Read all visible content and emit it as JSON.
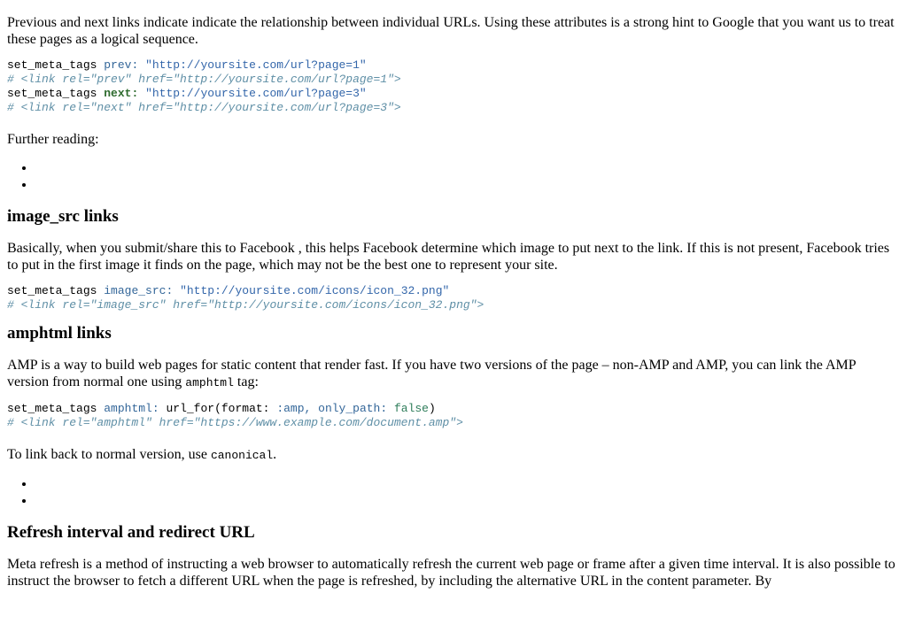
{
  "sections": {
    "prev_next": {
      "intro": "Previous and next links indicate indicate the relationship between individual URLs. Using these attributes is a strong hint to Google that you want us to treat these pages as a logical sequence.",
      "code": {
        "l1_cmd": "set_meta_tags",
        "l1_key": "prev:",
        "l1_val": "\"http://yoursite.com/url?page=1\"",
        "l2_comment": "# <link rel=\"prev\" href=\"http://yoursite.com/url?page=1\">",
        "l3_cmd": "set_meta_tags",
        "l3_key": "next:",
        "l3_val": "\"http://yoursite.com/url?page=3\"",
        "l4_comment": "# <link rel=\"next\" href=\"http://yoursite.com/url?page=3\">"
      },
      "further_reading": "Further reading:"
    },
    "image_src": {
      "heading": "image_src links",
      "body": "Basically, when you submit/share this to Facebook , this helps Facebook determine which image to put next to the link. If this is not present, Facebook tries to put in the first image it finds on the page, which may not be the best one to represent your site.",
      "code": {
        "l1_cmd": "set_meta_tags",
        "l1_key": "image_src:",
        "l1_val": "\"http://yoursite.com/icons/icon_32.png\"",
        "l2_comment": "# <link rel=\"image_src\" href=\"http://yoursite.com/icons/icon_32.png\">"
      }
    },
    "amphtml": {
      "heading": "amphtml links",
      "body_before": "AMP is a way to build web pages for static content that render fast. If you have two versions of the page – non-AMP and AMP, you can link the AMP version from normal one using ",
      "body_code": "amphtml",
      "body_after": " tag:",
      "code": {
        "l1_cmd": "set_meta_tags",
        "l1_key": "amphtml:",
        "l1_fn": "url_for(format:",
        "l1_sym": ":amp,",
        "l1_key2": "only_path:",
        "l1_false": "false",
        "l1_close": ")",
        "l2_comment": "# <link rel=\"amphtml\" href=\"https://www.example.com/document.amp\">"
      },
      "back_before": "To link back to normal version, use ",
      "back_code": "canonical",
      "back_after": "."
    },
    "refresh": {
      "heading": "Refresh interval and redirect URL",
      "body": "Meta refresh is a method of instructing a web browser to automatically refresh the current web page or frame after a given time interval. It is also possible to instruct the browser to fetch a different URL when the page is refreshed, by including the alternative URL in the content parameter. By"
    }
  }
}
